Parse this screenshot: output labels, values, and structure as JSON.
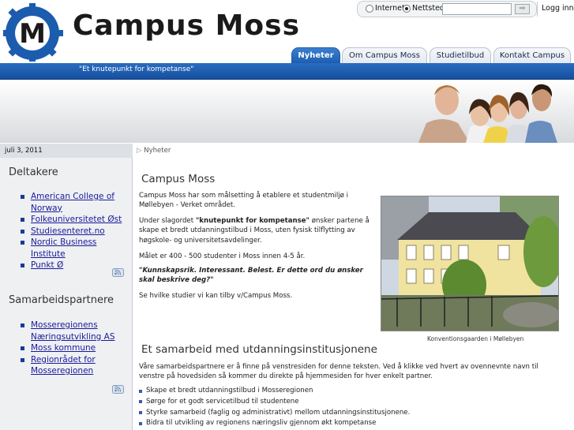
{
  "header": {
    "brand": "Campus Moss",
    "logo_letter": "M",
    "search": {
      "option_internet": "Internett",
      "option_site": "Nettsted",
      "selected": "Nettsted",
      "placeholder": "",
      "button": "⇨"
    },
    "login": "Logg inn",
    "slogan": "\"Et knutepunkt for kompetanse\""
  },
  "nav": {
    "tabs": [
      "Nyheter",
      "Om Campus Moss",
      "Studietilbud",
      "Kontakt Campus"
    ],
    "active": "Nyheter"
  },
  "date": "juli 3, 2011",
  "breadcrumb": "Nyheter",
  "sidebar": {
    "participants_heading": "Deltakere",
    "participants": [
      "American College of Norway",
      "Folkeuniversitetet Øst",
      "Studiesenteret.no",
      "Nordic Business Institute",
      "Punkt Ø"
    ],
    "partners_heading": "Samarbeidspartnere",
    "partners": [
      "Mosseregionens Næringsutvikling AS",
      "Moss kommune",
      "Regionrådet for Mosseregionen"
    ]
  },
  "main": {
    "title": "Campus Moss",
    "p1": "Campus Moss har som målsetting å etablere et studentmiljø i Møllebyen - Verket området.",
    "p2_prefix": "Under slagordet ",
    "p2_bold": "\"knutepunkt for kompetanse\"",
    "p2_suffix": " ønsker partene å skape et bredt utdanningstilbud i Moss, uten fysisk tilflytting av høgskole- og universitetsavdelinger.",
    "p3": "Målet er 400 - 500 studenter i Moss innen 4-5 år.",
    "p4": "\"Kunnskapsrik. Interessant. Belest. Er dette ord du ønsker skal beskrive deg?\"",
    "p5": "Se hvilke studier vi kan tilby v/Campus Moss.",
    "photo_caption": "Konventionsgaarden i Møllebyen",
    "section2_title": "Et samarbeid med utdanningsinstitusjonene",
    "section2_text": "Våre samarbeidspartnere er å finne på venstresiden for denne teksten. Ved å klikke ved hvert av ovennevnte navn til venstre på hovedsiden så kommer du direkte på hjemmesiden for hver enkelt partner.",
    "bullets": [
      "Skape et bredt utdanningstilbud i Mosseregionen",
      "Sørge for et godt servicetilbud til studentene",
      "Styrke samarbeid (faglig og administrativt) mellom utdanningsinstitusjonene.",
      "Bidra til utvikling av regionens næringsliv gjennom økt kompetanse"
    ]
  },
  "colors": {
    "brand_blue": "#1c5cae",
    "tab_active": "#2a6cc0",
    "link": "#1a1a9a"
  },
  "icons": [
    "logo-gear-icon",
    "search-arrow-icon",
    "rss-feed-icon",
    "breadcrumb-arrow-icon"
  ]
}
